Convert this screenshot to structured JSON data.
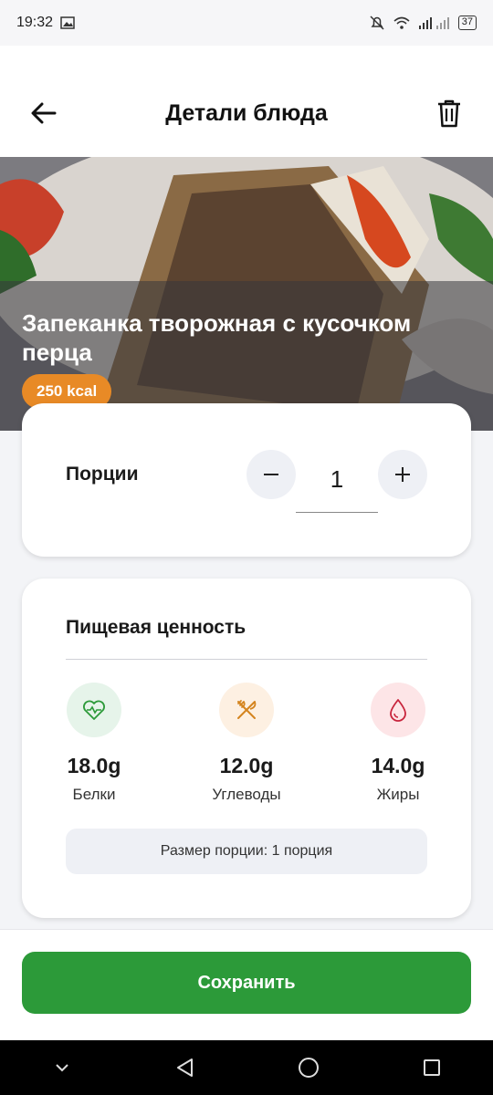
{
  "status": {
    "time": "19:32",
    "battery": "37"
  },
  "header": {
    "title": "Детали блюда"
  },
  "dish": {
    "name": "Запеканка творожная с кусочком перца",
    "calories": "250 kcal"
  },
  "portions": {
    "label": "Порции",
    "value": "1",
    "minus": "−",
    "plus": "+"
  },
  "nutrition": {
    "title": "Пищевая ценность",
    "protein": {
      "value": "18.0g",
      "label": "Белки",
      "color": "#e6f4ea"
    },
    "carbs": {
      "value": "12.0g",
      "label": "Углеводы",
      "color": "#fdf0e2"
    },
    "fat": {
      "value": "14.0g",
      "label": "Жиры",
      "color": "#fde5e7"
    },
    "serving_size": "Размер порции: 1 порция"
  },
  "actions": {
    "save": "Сохранить"
  },
  "colors": {
    "accent": "#2c9a39",
    "kcal_badge": "#e88a26"
  },
  "icons": [
    "back-arrow-icon",
    "trash-icon",
    "heart-pulse-icon",
    "fork-knife-icon",
    "drop-icon"
  ]
}
